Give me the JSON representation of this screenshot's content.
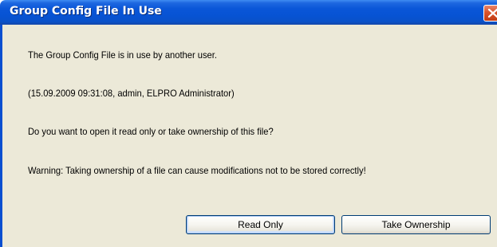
{
  "window": {
    "title": "Group Config File In Use",
    "close_icon": "close-icon"
  },
  "message": {
    "line1": "The Group Config File is in use by another user.",
    "line2": "(15.09.2009 09:31:08, admin, ELPRO Administrator)",
    "line3": "Do you want to open it read only or take ownership of this file?",
    "line4": "Warning: Taking ownership of a file can cause modifications not to be stored correctly!"
  },
  "buttons": {
    "read_only": "Read Only",
    "take_ownership": "Take Ownership"
  },
  "colors": {
    "titlebar": "#0753d3",
    "client_background": "#ece9d8",
    "close_button": "#d9532b"
  }
}
